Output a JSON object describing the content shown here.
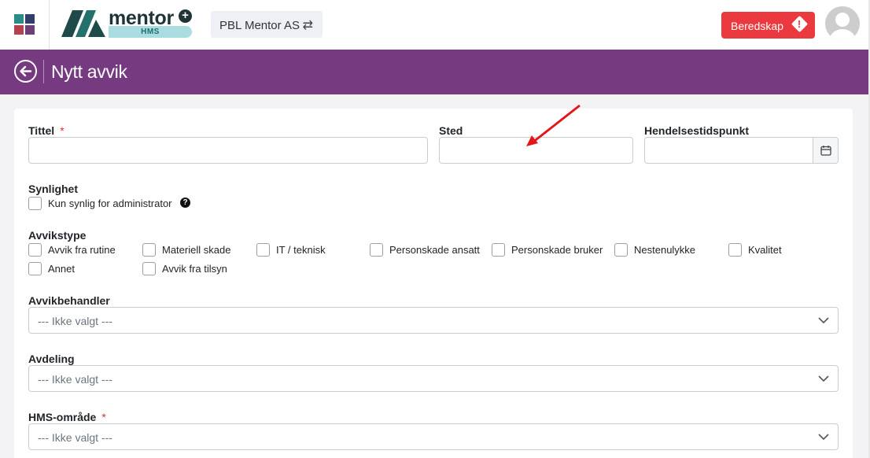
{
  "header": {
    "app_icon": "apps-grid-icon",
    "logo": {
      "word": "mentor",
      "plus": "+",
      "sub": "HMS"
    },
    "company": {
      "name": "PBL Mentor AS",
      "swap_icon": "⇄"
    },
    "beredskap_label": "Beredskap",
    "beredskap_icon": "!",
    "user_avatar": "user-avatar-icon"
  },
  "page": {
    "title": "Nytt avvik",
    "back_icon": "arrow-left-circle-icon"
  },
  "form": {
    "tittel": {
      "label": "Tittel",
      "required_mark": "*",
      "value": ""
    },
    "sted": {
      "label": "Sted",
      "value": ""
    },
    "hendelse": {
      "label": "Hendelsestidspunkt",
      "value": "",
      "icon": "calendar-icon"
    },
    "synlighet": {
      "label": "Synlighet",
      "option": "Kun synlig for administrator",
      "help": "?"
    },
    "avvikstype": {
      "label": "Avvikstype",
      "options": [
        "Avvik fra rutine",
        "Materiell skade",
        "IT / teknisk",
        "Personskade ansatt",
        "Personskade bruker",
        "Nestenulykke",
        "Kvalitet",
        "Annet",
        "Avvik fra tilsyn"
      ]
    },
    "avvikbehandler": {
      "label": "Avvikbehandler",
      "value": "--- Ikke valgt ---"
    },
    "avdeling": {
      "label": "Avdeling",
      "value": "--- Ikke valgt ---"
    },
    "hms_omrade": {
      "label": "HMS-område",
      "required_mark": "*",
      "value": "--- Ikke valgt ---"
    }
  },
  "colors": {
    "header_purple": "#763a80",
    "alert_red": "#eb3a3f",
    "required_red": "#e03131",
    "annotation_arrow": "#e3161c"
  }
}
